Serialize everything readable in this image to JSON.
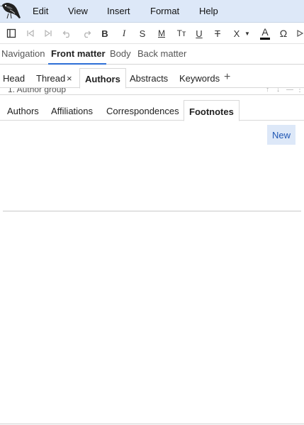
{
  "menubar": {
    "items": [
      "Edit",
      "View",
      "Insert",
      "Format",
      "Help"
    ]
  },
  "toolbar": {
    "icons": [
      "sidebar-toggle-icon",
      "first-icon",
      "last-icon",
      "undo-icon",
      "redo-icon",
      "bold-icon",
      "italic-icon",
      "strikethrough-icon",
      "monospace-icon",
      "small-caps-icon",
      "underline-icon",
      "strike-icon",
      "clear-format-icon",
      "text-color-icon",
      "special-character-icon",
      "more-icon"
    ],
    "bold": "B",
    "italic": "I",
    "strike": "S",
    "mono": "M",
    "smallcaps": "Tт",
    "underline": "U",
    "strike_through": "T",
    "clear": "X",
    "text_color": "A",
    "omega": "Ω",
    "text_color_value": "#000000"
  },
  "section_nav": {
    "tabs": [
      "Navigation",
      "Front matter",
      "Body",
      "Back matter"
    ],
    "active": "Front matter"
  },
  "front_matter_tabs": {
    "tabs": [
      "Head",
      "Thread",
      "Authors",
      "Abstracts",
      "Keywords"
    ],
    "close": "×",
    "add": "+",
    "active": "Authors"
  },
  "author_group": {
    "title": "1. Author group"
  },
  "inner_tabs": {
    "tabs": [
      "Authors",
      "Affiliations",
      "Correspondences",
      "Footnotes"
    ],
    "active": "Footnotes"
  },
  "actions": {
    "new_label": "New"
  },
  "colors": {
    "accent": "#2d6fd6",
    "menubar_bg": "#dde8f8",
    "button_text": "#1f56b3"
  }
}
